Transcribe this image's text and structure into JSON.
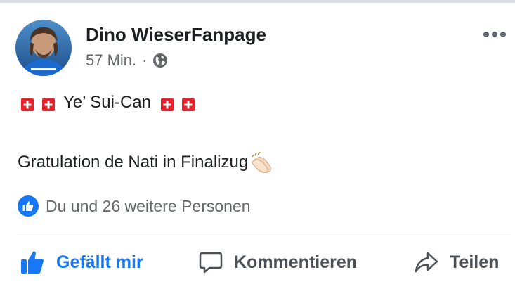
{
  "post": {
    "author_name": "Dino WieserFanpage",
    "timestamp": "57 Min.",
    "separator": "·",
    "privacy_icon": "globe-icon",
    "more_icon": "more-dots-icon",
    "line1_text": "Ye’ Sui-Can",
    "flag_icon": "swiss-flag-icon",
    "line2_text": "Gratulation de Nati in Finalizug",
    "emoji_icon": "clapping-hands-icon"
  },
  "reactions": {
    "icon": "like-thumb-icon",
    "text": "Du und 26 weitere Personen"
  },
  "actions": {
    "like_label": "Gefällt mir",
    "comment_label": "Kommentieren",
    "share_label": "Teilen"
  },
  "colors": {
    "accent": "#1877f2",
    "secondary_text": "#65676b",
    "swiss_red": "#e8202a"
  }
}
